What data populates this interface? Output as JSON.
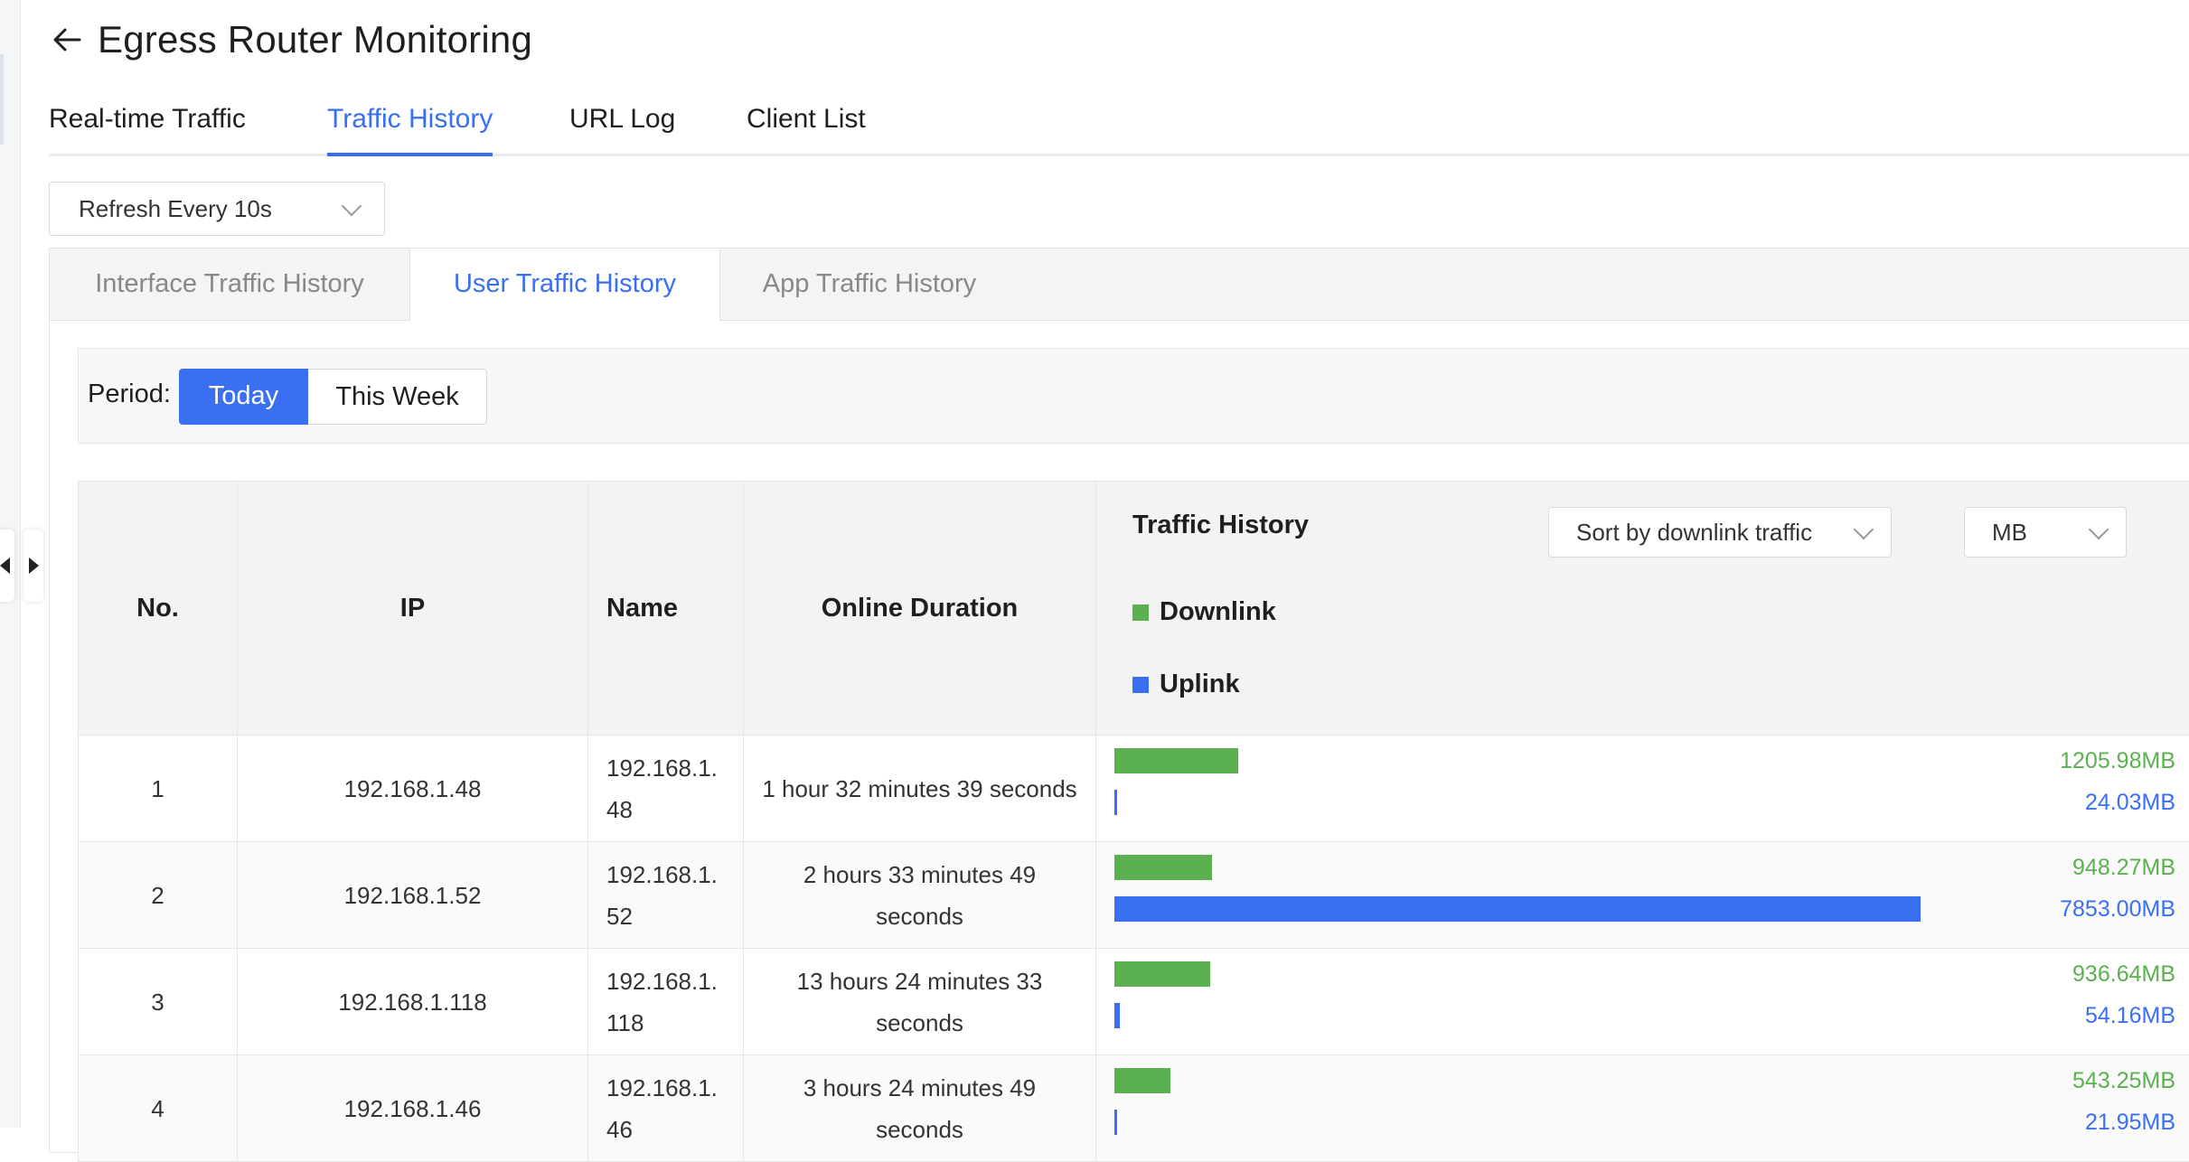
{
  "header": {
    "title": "Egress Router Monitoring"
  },
  "main_tabs": [
    {
      "label": "Real-time Traffic"
    },
    {
      "label": "Traffic History",
      "active": true
    },
    {
      "label": "URL Log"
    },
    {
      "label": "Client List"
    }
  ],
  "refresh": {
    "value": "Refresh Every 10s"
  },
  "sub_tabs": [
    {
      "label": "Interface Traffic History"
    },
    {
      "label": "User Traffic History",
      "active": true
    },
    {
      "label": "App Traffic History"
    }
  ],
  "period": {
    "label": "Period:",
    "options": [
      "Today",
      "This Week"
    ],
    "selected": "Today"
  },
  "table": {
    "columns": {
      "no": "No.",
      "ip": "IP",
      "name": "Name",
      "duration": "Online Duration",
      "traffic": "Traffic History"
    },
    "sort": {
      "value": "Sort by downlink traffic"
    },
    "unit": {
      "value": "MB"
    },
    "legend": {
      "downlink": "Downlink",
      "uplink": "Uplink"
    },
    "scale_max_mb": 10918,
    "rows": [
      {
        "no": "1",
        "ip": "192.168.1.48",
        "name": "192.168.1.48",
        "duration": "1 hour 32 minutes 39 seconds",
        "down_mb": 1205.98,
        "up_mb": 24.03,
        "down_label": "1205.98MB",
        "up_label": "24.03MB"
      },
      {
        "no": "2",
        "ip": "192.168.1.52",
        "name": "192.168.1.52",
        "duration": "2 hours 33 minutes 49 seconds",
        "down_mb": 948.27,
        "up_mb": 7853.0,
        "down_label": "948.27MB",
        "up_label": "7853.00MB"
      },
      {
        "no": "3",
        "ip": "192.168.1.118",
        "name": "192.168.1.118",
        "duration": "13 hours 24 minutes 33 seconds",
        "down_mb": 936.64,
        "up_mb": 54.16,
        "down_label": "936.64MB",
        "up_label": "54.16MB"
      },
      {
        "no": "4",
        "ip": "192.168.1.46",
        "name": "192.168.1.46",
        "duration": "3 hours 24 minutes 49 seconds",
        "down_mb": 543.25,
        "up_mb": 21.95,
        "down_label": "543.25MB",
        "up_label": "21.95MB"
      }
    ]
  },
  "colors": {
    "accent": "#3a6ff2",
    "downlink": "#5bb04f",
    "uplink": "#3a6ff2"
  }
}
